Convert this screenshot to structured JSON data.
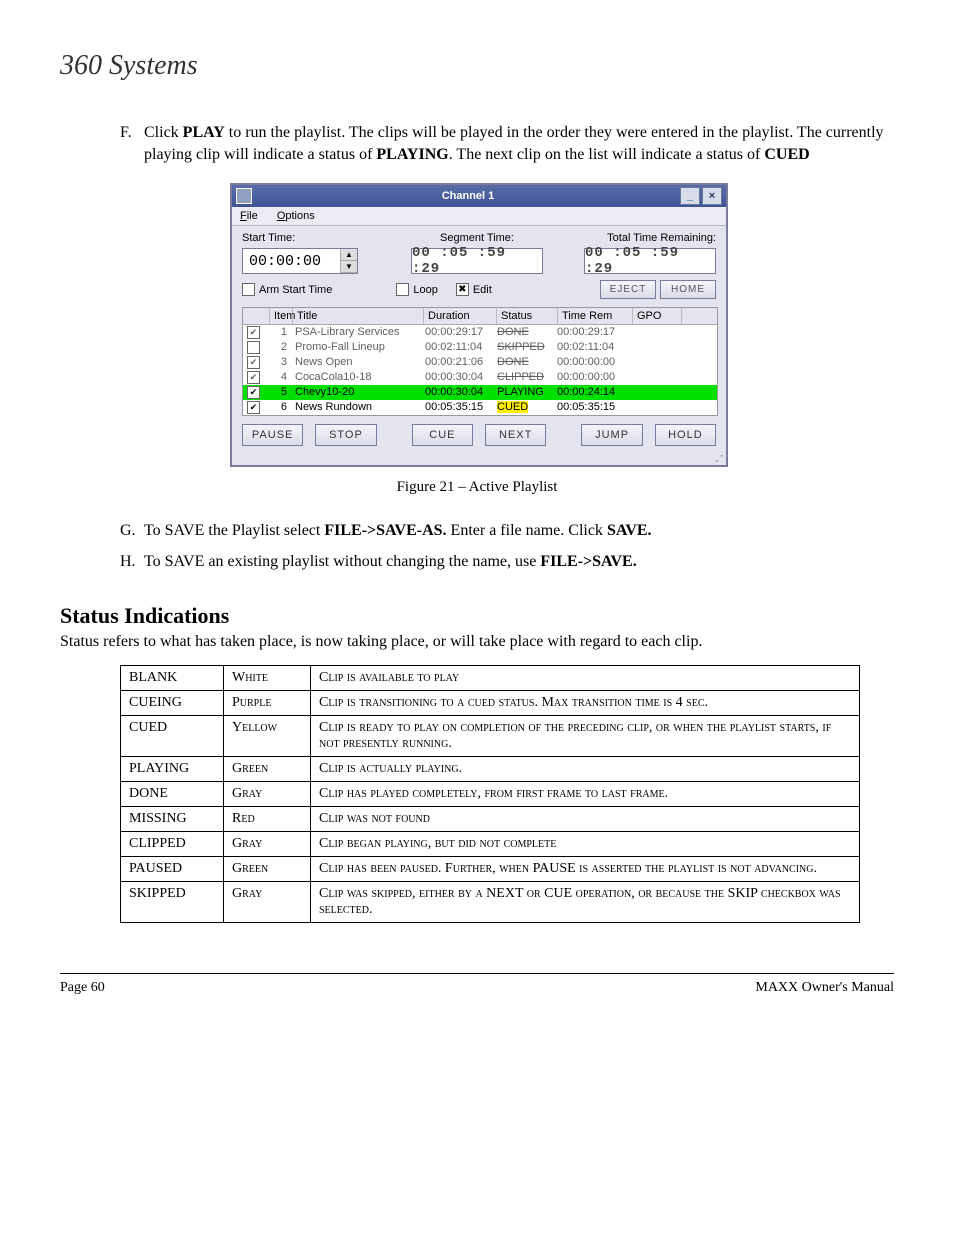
{
  "logo": "360 Systems",
  "instructions": {
    "F": {
      "letter": "F.",
      "pre": "Click ",
      "bold1": "PLAY",
      "mid": " to run the playlist. The clips will be played in the order they were entered in the playlist. The currently playing clip will indicate a status of ",
      "bold2": "PLAYING",
      "mid2": ". The next clip on the list will indicate a status of ",
      "bold3": "CUED"
    },
    "G": {
      "letter": "G.",
      "pre": "To SAVE the Playlist select ",
      "bold1": "FILE->SAVE-AS.",
      "mid": " Enter a file name. Click ",
      "bold2": "SAVE."
    },
    "H": {
      "letter": "H.",
      "pre": "To SAVE an existing playlist without changing the name, use ",
      "bold1": "FILE->SAVE."
    }
  },
  "window": {
    "title": "Channel  1",
    "menu": {
      "file": "File",
      "options": "Options"
    },
    "labels": {
      "start": "Start Time:",
      "segment": "Segment Time:",
      "total": "Total Time Remaining:"
    },
    "start_value": "00:00:00",
    "segment_value": "00 :05 :59 :29",
    "total_value": "00 :05 :59 :29",
    "checks": {
      "arm": "Arm Start Time",
      "loop": "Loop",
      "edit": "Edit"
    },
    "buttons": {
      "eject": "EJECT",
      "home": "HOME",
      "pause": "PAUSE",
      "stop": "STOP",
      "cue": "CUE",
      "next": "NEXT",
      "jump": "JUMP",
      "hold": "HOLD"
    },
    "headers": {
      "item": "Item",
      "title": "Title",
      "duration": "Duration",
      "status": "Status",
      "timerem": "Time Rem",
      "gpo": "GPO"
    },
    "rows": [
      {
        "chk": true,
        "n": "1",
        "title": "PSA-Library Services",
        "dur": "00:00:29:17",
        "status": "DONE",
        "cls": "st-done",
        "rowcls": "row-done",
        "tr": "00:00:29:17"
      },
      {
        "chk": false,
        "n": "2",
        "title": "Promo-Fall Lineup",
        "dur": "00:02:11:04",
        "status": "SKIPPED",
        "cls": "st-skipped",
        "rowcls": "row-done",
        "tr": "00:02:11:04"
      },
      {
        "chk": true,
        "n": "3",
        "title": "News Open",
        "dur": "00:00:21:06",
        "status": "DONE",
        "cls": "st-done",
        "rowcls": "row-done",
        "tr": "00:00:00:00"
      },
      {
        "chk": true,
        "n": "4",
        "title": "CocaCola10-18",
        "dur": "00:00:30:04",
        "status": "CLIPPED",
        "cls": "st-clipped",
        "rowcls": "row-done",
        "tr": "00:00:00:00"
      },
      {
        "chk": true,
        "n": "5",
        "title": "Chevy10-20",
        "dur": "00:00:30:04",
        "status": "PLAYING",
        "cls": "st-playing",
        "rowcls": "row-playing",
        "tr": "00:00:24:14"
      },
      {
        "chk": true,
        "n": "6",
        "title": "News Rundown",
        "dur": "00:05:35:15",
        "status": "CUED",
        "cls": "st-cued",
        "rowcls": "",
        "tr": "00:05:35:15"
      }
    ]
  },
  "caption": "Figure 21 – Active Playlist",
  "section": {
    "title": "Status Indications",
    "para": "Status refers to what has taken place, is now taking place, or will take place with regard to each clip."
  },
  "status_table": [
    {
      "a": "BLANK",
      "b": "White",
      "c": "Clip is available to play"
    },
    {
      "a": "CUEING",
      "b": "Purple",
      "c": "Clip is transitioning to a cued status. Max transition time is 4 sec."
    },
    {
      "a": "CUED",
      "b": "Yellow",
      "c": "Clip is ready to play on completion of the preceding clip, or when the playlist starts, if not presently running."
    },
    {
      "a": "PLAYING",
      "b": "Green",
      "c": "Clip is actually playing."
    },
    {
      "a": "DONE",
      "b": "Gray",
      "c": "Clip has played completely, from first frame to last frame."
    },
    {
      "a": "MISSING",
      "b": "Red",
      "c": "Clip was not found"
    },
    {
      "a": "CLIPPED",
      "b": "Gray",
      "c": "Clip began playing, but did not complete"
    },
    {
      "a": "PAUSED",
      "b": "Green",
      "c": "Clip has been paused. Further, when PAUSE is asserted the playlist is not advancing."
    },
    {
      "a": "SKIPPED",
      "b": "Gray",
      "c": "Clip was skipped, either by a NEXT or CUE operation, or because the SKIP checkbox was selected."
    }
  ],
  "footer": {
    "left": "Page 60",
    "right": "MAXX Owner's Manual"
  }
}
